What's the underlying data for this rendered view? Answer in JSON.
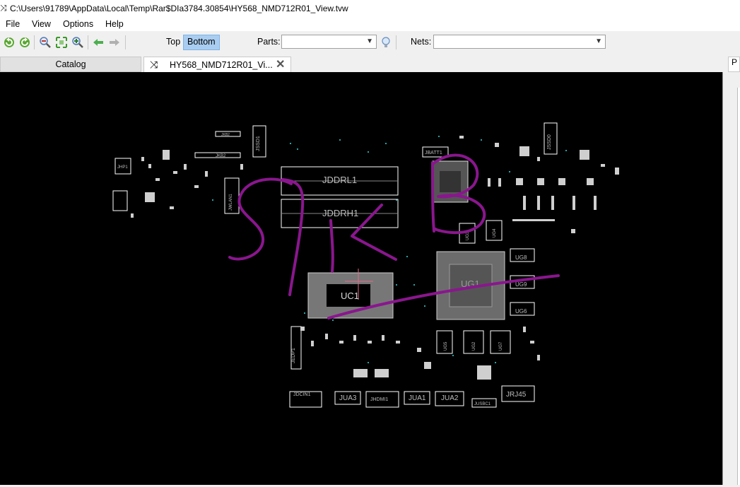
{
  "window": {
    "title": "C:\\Users\\91789\\AppData\\Local\\Temp\\Rar$DIa3784.30854\\HY568_NMD712R01_View.tvw"
  },
  "menu": {
    "items": [
      "File",
      "View",
      "Options",
      "Help"
    ]
  },
  "toolbar": {
    "top_label": "Top",
    "bottom_label": "Bottom",
    "parts_label": "Parts:",
    "parts_value": "",
    "nets_label": "Nets:",
    "nets_value": ""
  },
  "tabs": {
    "catalog": "Catalog",
    "view": "HY568_NMD712R01_Vi...",
    "right": "P"
  },
  "board": {
    "labels": {
      "JDDRL1": "JDDRL1",
      "JDDRH1": "JDDRH1",
      "UC1": "UC1",
      "UG1": "UG1",
      "JSSD1": "JSSD1",
      "JSSD0": "JSSD0",
      "JBATT1": "JBATT1",
      "JHP1": "JHP1",
      "JEDP1": "JEDP1",
      "JDCIN1": "JDCIN1",
      "JUA3": "JUA3",
      "JHDMI1": "JHDMI1",
      "JUA1": "JUA1",
      "JUA2": "JUA2",
      "JUSBC1": "JUSBC1",
      "JRJ45": "JRJ45",
      "JKB2": "JKB2",
      "JWLAN1": "JWLAN1",
      "UG3": "UG3",
      "UG4": "UG4",
      "UG8": "UG8",
      "UG5": "UG5",
      "UG6": "UG6",
      "UG2": "UG2",
      "UG7": "UG7",
      "UG9": "UG9"
    }
  },
  "colors": {
    "annotation": "#8a168e",
    "silkscreen": "#ffffff",
    "selection": "#a9cdf1",
    "canvas": "#000000"
  }
}
